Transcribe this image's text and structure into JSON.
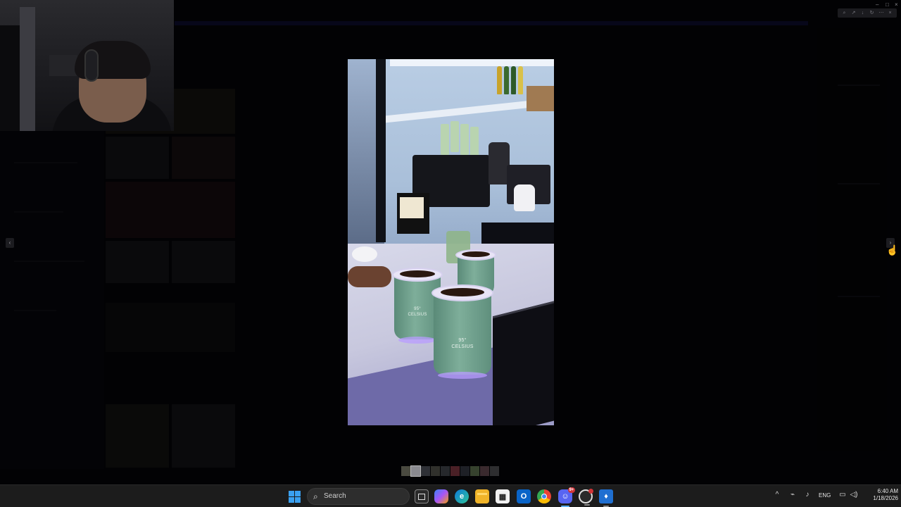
{
  "viewer": {
    "toolbar_icons": [
      "zoom-icon",
      "share-icon",
      "download-icon",
      "rotate-icon",
      "more-icon",
      "close-icon"
    ],
    "prev_icon": "‹",
    "next_icon": "›",
    "photo_cup_logo_1": "CELSIUS",
    "photo_cup_logo_2": "CELSIUS",
    "photo_cup_temp_1": "95°",
    "photo_cup_temp_2": "95°",
    "thumbnail_count": 10,
    "active_thumbnail_index": 1
  },
  "taskbar": {
    "search_label": "Search",
    "discord_badge": "9+",
    "colors": {
      "windows_accent": "#3aa0f0",
      "active_indicator": "#5fb2ff",
      "badge": "#d13438"
    }
  },
  "tray": {
    "language": "ENG",
    "time": "6:40 AM",
    "date": "1/18/2026"
  }
}
